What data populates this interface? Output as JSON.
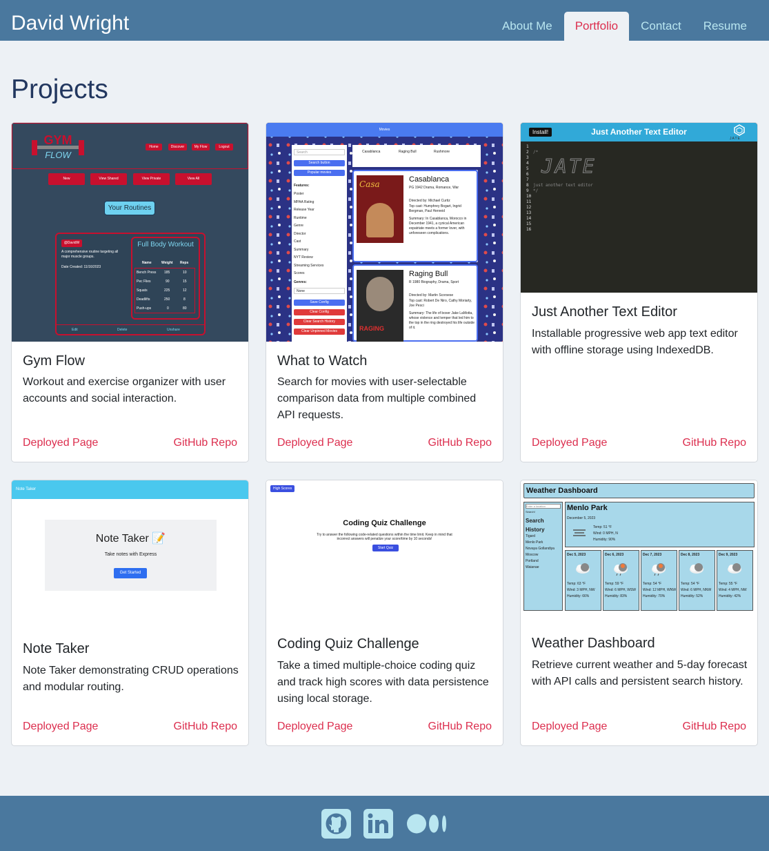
{
  "header": {
    "brand": "David Wright",
    "nav": [
      "About Me",
      "Portfolio",
      "Contact",
      "Resume"
    ],
    "active": "Portfolio"
  },
  "page_title": "Projects",
  "links": {
    "deployed": "Deployed Page",
    "repo": "GitHub Repo"
  },
  "projects": [
    {
      "title": "Gym Flow",
      "desc": "Workout and exercise organizer with user accounts and social interaction."
    },
    {
      "title": "What to Watch",
      "desc": "Search for movies with user-selectable comparison data from multiple combined API requests."
    },
    {
      "title": "Just Another Text Editor",
      "desc": "Installable progressive web app text editor with offline storage using IndexedDB."
    },
    {
      "title": "Note Taker",
      "desc": "Note Taker demonstrating CRUD operations and modular routing."
    },
    {
      "title": "Coding Quiz Challenge",
      "desc": "Take a timed multiple-choice coding quiz and track high scores with data persistence using local storage."
    },
    {
      "title": "Weather Dashboard",
      "desc": "Retrieve current weather and 5-day forecast with API calls and persistent search history."
    }
  ],
  "thumbs": {
    "gym": {
      "nav": [
        "Home",
        "Discover",
        "My Flow",
        "Logout"
      ],
      "buttons": [
        "New",
        "View Shared",
        "View Private",
        "View All"
      ],
      "routines": "Your Routines",
      "user": "@DavidW",
      "summary": "A comprehensive routine targeting all major muscle groups.",
      "date": "Date Created: 11/16/2023",
      "workout": "Full Body Workout",
      "cols": [
        "Name",
        "Weight",
        "Reps"
      ],
      "rows": [
        [
          "Bench Press",
          "185",
          "10"
        ],
        [
          "Pec Flies",
          "90",
          "15"
        ],
        [
          "Squats",
          "225",
          "12"
        ],
        [
          "Deadlifts",
          "250",
          "8"
        ],
        [
          "Push-ups",
          "0",
          "80"
        ]
      ],
      "actions": [
        "Edit",
        "Delete",
        "Unshare"
      ]
    },
    "watch": {
      "bar": "Movies",
      "search": "Search",
      "search_btn": "Search button",
      "popular": "Popular movies",
      "features_label": "Features:",
      "features": [
        "Poster",
        "MPAA Rating",
        "Release Year",
        "Runtime",
        "Genre",
        "Director",
        "Cast",
        "Summary",
        "NYT Review",
        "Streaming Services",
        "Scores"
      ],
      "genres_label": "Genres:",
      "genre_value": "None",
      "btns": [
        "Save Config",
        "Clear Config",
        "Clear Search History",
        "Clear Unpinned Movies"
      ],
      "tabs": [
        "Casablanca",
        "Raging Bull",
        "Rushmore"
      ],
      "m1": {
        "title": "Casablanca",
        "meta": "PG 1942 Drama, Romance, War",
        "dir": "Directed by: Michael Curtiz",
        "cast": "Top cast: Humphrey Bogart, Ingrid Bergman, Paul Henreid",
        "sum": "Summary: In Casablanca, Morocco in December 1941, a cynical American expatriate meets a former lover, with unforeseen complications."
      },
      "m2": {
        "title": "Raging Bull",
        "meta": "R 1980 Biography, Drama, Sport",
        "dir": "Directed by: Martin Scorsese",
        "cast": "Top cast: Robert De Niro, Cathy Moriarty, Joe Pesci",
        "sum": "Summary: The life of boxer Jake LaMotta, whose violence and temper that led him to the top in the ring destroyed his life outside of it."
      }
    },
    "jate": {
      "install": "Install!",
      "title": "Just Another Text Editor",
      "logo": "JATE",
      "lines": [
        "1",
        "2",
        "3",
        "4",
        "5",
        "6",
        "7",
        "8",
        "9",
        "10",
        "11",
        "12",
        "13",
        "14",
        "15",
        "16"
      ],
      "code1": "/*",
      "code_logo": "JATE",
      "code2": "just another text editor",
      "code3": "*/"
    },
    "note": {
      "bar": "Note Taker",
      "title": "Note Taker 📝",
      "sub": "Take notes with Express",
      "btn": "Get Started"
    },
    "quiz": {
      "scores": "High Scores",
      "title": "Coding Quiz Challenge",
      "text": "Try to answer the following code-related questions within the time limit. Keep in mind that incorrect answers will penalize your score/time by 10 seconds!",
      "btn": "Start Quiz"
    },
    "weather": {
      "title": "Weather Dashboard",
      "input": "Enter a location",
      "search_btn": "Search!",
      "history_label": "Search History",
      "history": [
        "Tigard",
        "Menlo Park",
        "Novaya Gollandiya",
        "Moscow",
        "Portland",
        "Waianae"
      ],
      "city": "Menlo Park",
      "date": "December 5, 2023",
      "temp": "Temp: 51 °F",
      "wind": "Wind: 0 MPH, N",
      "hum": "Humidity: 90%",
      "days": [
        {
          "d": "Dec 5, 2023",
          "t": "Temp: 63 °F",
          "w": "Wind: 3 MPH, NW",
          "h": "Humidity: 66%"
        },
        {
          "d": "Dec 6, 2023",
          "t": "Temp: 59 °F",
          "w": "Wind: 6 MPH, WSW",
          "h": "Humidity: 83%"
        },
        {
          "d": "Dec 7, 2023",
          "t": "Temp: 54 °F",
          "w": "Wind: 12 MPH, WNW",
          "h": "Humidity: 70%"
        },
        {
          "d": "Dec 8, 2023",
          "t": "Temp: 54 °F",
          "w": "Wind: 6 MPH, NNW",
          "h": "Humidity: 52%"
        },
        {
          "d": "Dec 9, 2023",
          "t": "Temp: 55 °F",
          "w": "Wind: 4 MPH, NW",
          "h": "Humidity: 42%"
        }
      ]
    }
  },
  "social": [
    "github-icon",
    "linkedin-icon",
    "medium-icon"
  ],
  "colors": {
    "header": "#4a789e",
    "accent": "#dc2e4e",
    "nav_text": "#b9e6f0",
    "title": "#22375f",
    "background": "#edf1f5"
  }
}
